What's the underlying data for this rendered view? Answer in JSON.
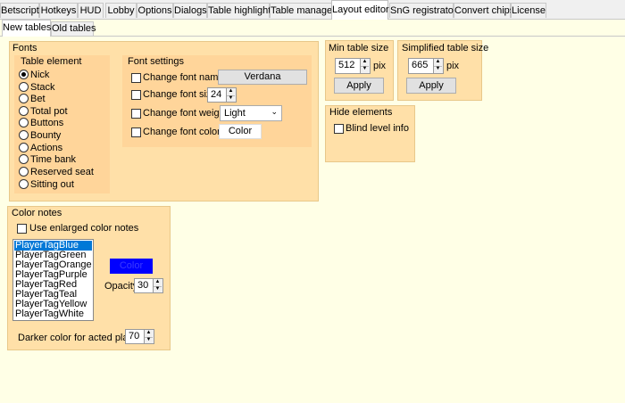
{
  "tabs": [
    "Betscript",
    "Hotkeys",
    "HUD",
    "Lobby",
    "Options",
    "Dialogs",
    "Table highlight",
    "Table manager",
    "Layout editor",
    "SnG registrator",
    "Convert chips",
    "License"
  ],
  "subtabs": [
    "New tables",
    "Old tables"
  ],
  "fonts": {
    "title": "Fonts",
    "table_element_title": "Table element",
    "elements": [
      "Nick",
      "Stack",
      "Bet",
      "Total pot",
      "Buttons",
      "Bounty",
      "Actions",
      "Time bank",
      "Reserved seat",
      "Sitting out"
    ],
    "settings_title": "Font settings",
    "change_name_label": "Change font name",
    "font_name_value": "Verdana",
    "change_size_label": "Change font size",
    "font_size_value": "24",
    "change_weight_label": "Change font weight",
    "font_weight_value": "Light",
    "change_color_label": "Change font color",
    "color_button": "Color"
  },
  "min_table": {
    "title": "Min table size",
    "value": "512",
    "unit": "pix",
    "apply": "Apply"
  },
  "simplified_table": {
    "title": "Simplified table size",
    "value": "665",
    "unit": "pix",
    "apply": "Apply"
  },
  "hide_elements": {
    "title": "Hide elements",
    "blind_level": "Blind level info"
  },
  "color_notes": {
    "title": "Color notes",
    "use_enlarged": "Use enlarged color notes",
    "items": [
      "PlayerTagBlue",
      "PlayerTagGreen",
      "PlayerTagOrange",
      "PlayerTagPurple",
      "PlayerTagRed",
      "PlayerTagTeal",
      "PlayerTagYellow",
      "PlayerTagWhite"
    ],
    "selected_index": 0,
    "color_swatch_label": "Color",
    "swatch_color": "#0000ff",
    "opacity_label": "Opacity",
    "opacity_value": "30",
    "darker_label": "Darker color for acted player",
    "darker_value": "70"
  }
}
